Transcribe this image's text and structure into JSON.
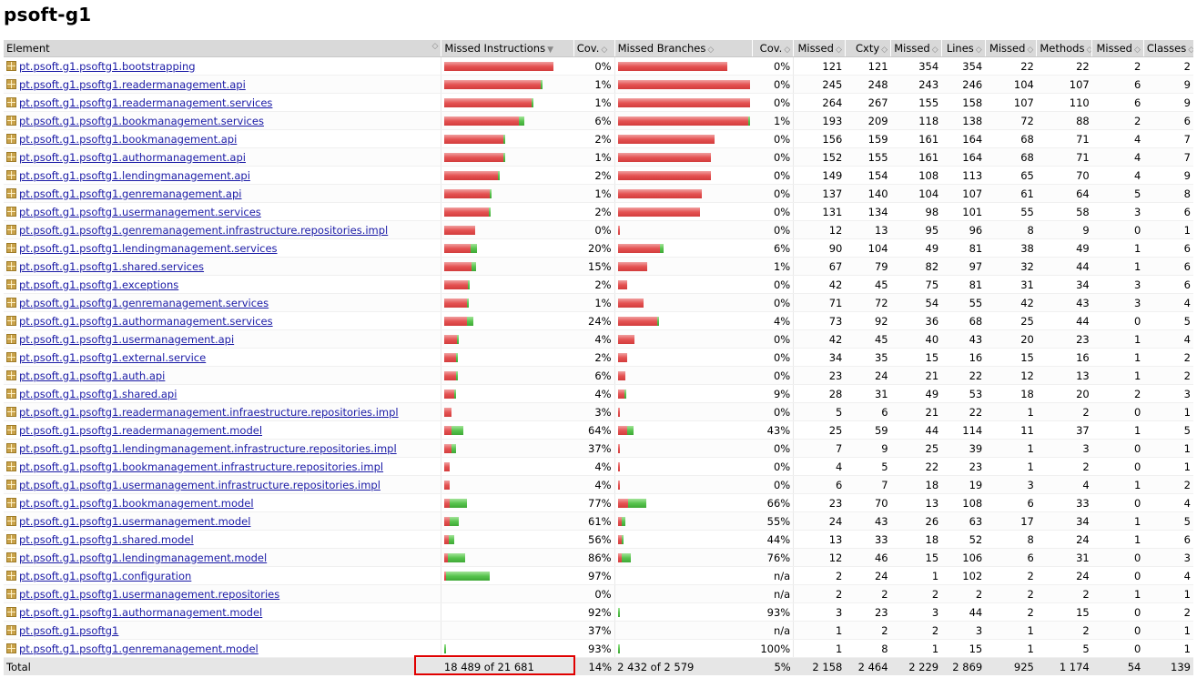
{
  "page_title": "psoft-g1",
  "colors": {
    "missed_bar": "#e55353",
    "covered_bar": "#58c44e",
    "highlight": "#e00000"
  },
  "icons": {
    "package": "package-icon",
    "sort": "sort-icon"
  },
  "headers": [
    "Element",
    "Missed Instructions",
    "Cov.",
    "Missed Branches",
    "Cov.",
    "Missed",
    "Cxty",
    "Missed",
    "Lines",
    "Missed",
    "Methods",
    "Missed",
    "Classes"
  ],
  "rows": [
    {
      "name": "pt.psoft.g1.psoftg1.bootstrapping",
      "mi": 100,
      "ci": 0,
      "icov": "0%",
      "mb": 100,
      "cb": 0,
      "bcov": "0%",
      "mc": "121",
      "cx": "121",
      "ml": "354",
      "ln": "354",
      "mm": "22",
      "mt": "22",
      "mcl": "2",
      "cl": "2"
    },
    {
      "name": "pt.psoft.g1.psoftg1.readermanagement.api",
      "mi": 88,
      "ci": 1,
      "icov": "1%",
      "mb": 142,
      "cb": 0,
      "bcov": "0%",
      "mc": "245",
      "cx": "248",
      "ml": "243",
      "ln": "246",
      "mm": "104",
      "mt": "107",
      "mcl": "6",
      "cl": "9"
    },
    {
      "name": "pt.psoft.g1.psoftg1.readermanagement.services",
      "mi": 80,
      "ci": 1,
      "icov": "1%",
      "mb": 153,
      "cb": 0,
      "bcov": "0%",
      "mc": "264",
      "cx": "267",
      "ml": "155",
      "ln": "158",
      "mm": "107",
      "mt": "110",
      "mcl": "6",
      "cl": "9"
    },
    {
      "name": "pt.psoft.g1.psoftg1.bookmanagement.services",
      "mi": 68,
      "ci": 5,
      "icov": "6%",
      "mb": 119,
      "cb": 2,
      "bcov": "1%",
      "mc": "193",
      "cx": "209",
      "ml": "118",
      "ln": "138",
      "mm": "72",
      "mt": "88",
      "mcl": "2",
      "cl": "6"
    },
    {
      "name": "pt.psoft.g1.psoftg1.bookmanagement.api",
      "mi": 54,
      "ci": 1,
      "icov": "2%",
      "mb": 88,
      "cb": 0,
      "bcov": "0%",
      "mc": "156",
      "cx": "159",
      "ml": "161",
      "ln": "164",
      "mm": "68",
      "mt": "71",
      "mcl": "4",
      "cl": "7"
    },
    {
      "name": "pt.psoft.g1.psoftg1.authormanagement.api",
      "mi": 54,
      "ci": 1,
      "icov": "1%",
      "mb": 85,
      "cb": 0,
      "bcov": "0%",
      "mc": "152",
      "cx": "155",
      "ml": "161",
      "ln": "164",
      "mm": "68",
      "mt": "71",
      "mcl": "4",
      "cl": "7"
    },
    {
      "name": "pt.psoft.g1.psoftg1.lendingmanagement.api",
      "mi": 49,
      "ci": 1,
      "icov": "2%",
      "mb": 85,
      "cb": 0,
      "bcov": "0%",
      "mc": "149",
      "cx": "154",
      "ml": "108",
      "ln": "113",
      "mm": "65",
      "mt": "70",
      "mcl": "4",
      "cl": "9"
    },
    {
      "name": "pt.psoft.g1.psoftg1.genremanagement.api",
      "mi": 42,
      "ci": 1,
      "icov": "1%",
      "mb": 77,
      "cb": 0,
      "bcov": "0%",
      "mc": "137",
      "cx": "140",
      "ml": "104",
      "ln": "107",
      "mm": "61",
      "mt": "64",
      "mcl": "5",
      "cl": "8"
    },
    {
      "name": "pt.psoft.g1.psoftg1.usermanagement.services",
      "mi": 41,
      "ci": 1,
      "icov": "2%",
      "mb": 75,
      "cb": 0,
      "bcov": "0%",
      "mc": "131",
      "cx": "134",
      "ml": "98",
      "ln": "101",
      "mm": "55",
      "mt": "58",
      "mcl": "3",
      "cl": "6"
    },
    {
      "name": "pt.psoft.g1.psoftg1.genremanagement.infrastructure.repositories.impl",
      "mi": 28,
      "ci": 0,
      "icov": "0%",
      "mb": 2,
      "cb": 0,
      "bcov": "0%",
      "mc": "12",
      "cx": "13",
      "ml": "95",
      "ln": "96",
      "mm": "8",
      "mt": "9",
      "mcl": "0",
      "cl": "1"
    },
    {
      "name": "pt.psoft.g1.psoftg1.lendingmanagement.services",
      "mi": 24,
      "ci": 6,
      "icov": "20%",
      "mb": 38,
      "cb": 3,
      "bcov": "6%",
      "mc": "90",
      "cx": "104",
      "ml": "49",
      "ln": "81",
      "mm": "38",
      "mt": "49",
      "mcl": "1",
      "cl": "6"
    },
    {
      "name": "pt.psoft.g1.psoftg1.shared.services",
      "mi": 25,
      "ci": 4,
      "icov": "15%",
      "mb": 27,
      "cb": 0,
      "bcov": "1%",
      "mc": "67",
      "cx": "79",
      "ml": "82",
      "ln": "97",
      "mm": "32",
      "mt": "44",
      "mcl": "1",
      "cl": "6"
    },
    {
      "name": "pt.psoft.g1.psoftg1.exceptions",
      "mi": 22,
      "ci": 1,
      "icov": "2%",
      "mb": 8,
      "cb": 0,
      "bcov": "0%",
      "mc": "42",
      "cx": "45",
      "ml": "75",
      "ln": "81",
      "mm": "31",
      "mt": "34",
      "mcl": "3",
      "cl": "6"
    },
    {
      "name": "pt.psoft.g1.psoftg1.genremanagement.services",
      "mi": 21,
      "ci": 1,
      "icov": "1%",
      "mb": 23,
      "cb": 0,
      "bcov": "0%",
      "mc": "71",
      "cx": "72",
      "ml": "54",
      "ln": "55",
      "mm": "42",
      "mt": "43",
      "mcl": "3",
      "cl": "4"
    },
    {
      "name": "pt.psoft.g1.psoftg1.authormanagement.services",
      "mi": 21,
      "ci": 6,
      "icov": "24%",
      "mb": 36,
      "cb": 1,
      "bcov": "4%",
      "mc": "73",
      "cx": "92",
      "ml": "36",
      "ln": "68",
      "mm": "25",
      "mt": "44",
      "mcl": "0",
      "cl": "5"
    },
    {
      "name": "pt.psoft.g1.psoftg1.usermanagement.api",
      "mi": 12,
      "ci": 1,
      "icov": "4%",
      "mb": 15,
      "cb": 0,
      "bcov": "0%",
      "mc": "42",
      "cx": "45",
      "ml": "40",
      "ln": "43",
      "mm": "20",
      "mt": "23",
      "mcl": "1",
      "cl": "4"
    },
    {
      "name": "pt.psoft.g1.psoftg1.external.service",
      "mi": 11,
      "ci": 1,
      "icov": "2%",
      "mb": 8,
      "cb": 0,
      "bcov": "0%",
      "mc": "34",
      "cx": "35",
      "ml": "15",
      "ln": "16",
      "mm": "15",
      "mt": "16",
      "mcl": "1",
      "cl": "2"
    },
    {
      "name": "pt.psoft.g1.psoftg1.auth.api",
      "mi": 11,
      "ci": 1,
      "icov": "6%",
      "mb": 7,
      "cb": 0,
      "bcov": "0%",
      "mc": "23",
      "cx": "24",
      "ml": "21",
      "ln": "22",
      "mm": "12",
      "mt": "13",
      "mcl": "1",
      "cl": "2"
    },
    {
      "name": "pt.psoft.g1.psoftg1.shared.api",
      "mi": 9,
      "ci": 1,
      "icov": "4%",
      "mb": 6,
      "cb": 1,
      "bcov": "9%",
      "mc": "28",
      "cx": "31",
      "ml": "49",
      "ln": "53",
      "mm": "18",
      "mt": "20",
      "mcl": "2",
      "cl": "3"
    },
    {
      "name": "pt.psoft.g1.psoftg1.readermanagement.infraestructure.repositories.impl",
      "mi": 7,
      "ci": 0,
      "icov": "3%",
      "mb": 2,
      "cb": 0,
      "bcov": "0%",
      "mc": "5",
      "cx": "6",
      "ml": "21",
      "ln": "22",
      "mm": "1",
      "mt": "2",
      "mcl": "0",
      "cl": "1"
    },
    {
      "name": "pt.psoft.g1.psoftg1.readermanagement.model",
      "mi": 7,
      "ci": 11,
      "icov": "64%",
      "mb": 8,
      "cb": 6,
      "bcov": "43%",
      "mc": "25",
      "cx": "59",
      "ml": "44",
      "ln": "114",
      "mm": "11",
      "mt": "37",
      "mcl": "1",
      "cl": "5"
    },
    {
      "name": "pt.psoft.g1.psoftg1.lendingmanagement.infrastructure.repositories.impl",
      "mi": 7,
      "ci": 4,
      "icov": "37%",
      "mb": 2,
      "cb": 0,
      "bcov": "0%",
      "mc": "7",
      "cx": "9",
      "ml": "25",
      "ln": "39",
      "mm": "1",
      "mt": "3",
      "mcl": "0",
      "cl": "1"
    },
    {
      "name": "pt.psoft.g1.psoftg1.bookmanagement.infrastructure.repositories.impl",
      "mi": 5,
      "ci": 0,
      "icov": "4%",
      "mb": 2,
      "cb": 0,
      "bcov": "0%",
      "mc": "4",
      "cx": "5",
      "ml": "22",
      "ln": "23",
      "mm": "1",
      "mt": "2",
      "mcl": "0",
      "cl": "1"
    },
    {
      "name": "pt.psoft.g1.psoftg1.usermanagement.infrastructure.repositories.impl",
      "mi": 5,
      "ci": 0,
      "icov": "4%",
      "mb": 2,
      "cb": 0,
      "bcov": "0%",
      "mc": "6",
      "cx": "7",
      "ml": "18",
      "ln": "19",
      "mm": "3",
      "mt": "4",
      "mcl": "1",
      "cl": "2"
    },
    {
      "name": "pt.psoft.g1.psoftg1.bookmanagement.model",
      "mi": 5,
      "ci": 16,
      "icov": "77%",
      "mb": 9,
      "cb": 17,
      "bcov": "66%",
      "mc": "23",
      "cx": "70",
      "ml": "13",
      "ln": "108",
      "mm": "6",
      "mt": "33",
      "mcl": "0",
      "cl": "4"
    },
    {
      "name": "pt.psoft.g1.psoftg1.usermanagement.model",
      "mi": 5,
      "ci": 8,
      "icov": "61%",
      "mb": 3,
      "cb": 3,
      "bcov": "55%",
      "mc": "24",
      "cx": "43",
      "ml": "26",
      "ln": "63",
      "mm": "17",
      "mt": "34",
      "mcl": "1",
      "cl": "5"
    },
    {
      "name": "pt.psoft.g1.psoftg1.shared.model",
      "mi": 4,
      "ci": 5,
      "icov": "56%",
      "mb": 3,
      "cb": 2,
      "bcov": "44%",
      "mc": "13",
      "cx": "33",
      "ml": "18",
      "ln": "52",
      "mm": "8",
      "mt": "24",
      "mcl": "1",
      "cl": "6"
    },
    {
      "name": "pt.psoft.g1.psoftg1.lendingmanagement.model",
      "mi": 3,
      "ci": 16,
      "icov": "86%",
      "mb": 3,
      "cb": 8,
      "bcov": "76%",
      "mc": "12",
      "cx": "46",
      "ml": "15",
      "ln": "106",
      "mm": "6",
      "mt": "31",
      "mcl": "0",
      "cl": "3"
    },
    {
      "name": "pt.psoft.g1.psoftg1.configuration",
      "mi": 1,
      "ci": 40,
      "icov": "97%",
      "mb": 0,
      "cb": 0,
      "bcov": "n/a",
      "mc": "2",
      "cx": "24",
      "ml": "1",
      "ln": "102",
      "mm": "2",
      "mt": "24",
      "mcl": "0",
      "cl": "4"
    },
    {
      "name": "pt.psoft.g1.psoftg1.usermanagement.repositories",
      "mi": 0,
      "ci": 0,
      "icov": "0%",
      "mb": 0,
      "cb": 0,
      "bcov": "n/a",
      "mc": "2",
      "cx": "2",
      "ml": "2",
      "ln": "2",
      "mm": "2",
      "mt": "2",
      "mcl": "1",
      "cl": "1"
    },
    {
      "name": "pt.psoft.g1.psoftg1.authormanagement.model",
      "mi": 0,
      "ci": 0,
      "icov": "92%",
      "mb": 0,
      "cb": 2,
      "bcov": "93%",
      "mc": "3",
      "cx": "23",
      "ml": "3",
      "ln": "44",
      "mm": "2",
      "mt": "15",
      "mcl": "0",
      "cl": "2"
    },
    {
      "name": "pt.psoft.g1.psoftg1",
      "mi": 0,
      "ci": 0,
      "icov": "37%",
      "mb": 0,
      "cb": 0,
      "bcov": "n/a",
      "mc": "1",
      "cx": "2",
      "ml": "2",
      "ln": "3",
      "mm": "1",
      "mt": "2",
      "mcl": "0",
      "cl": "1"
    },
    {
      "name": "pt.psoft.g1.psoftg1.genremanagement.model",
      "mi": 0,
      "ci": 1,
      "icov": "93%",
      "mb": 0,
      "cb": 1,
      "bcov": "100%",
      "mc": "1",
      "cx": "8",
      "ml": "1",
      "ln": "15",
      "mm": "1",
      "mt": "5",
      "mcl": "0",
      "cl": "1"
    }
  ],
  "total": {
    "label": "Total",
    "instructions": "18 489 of 21 681",
    "icov": "14%",
    "branches": "2 432 of 2 579",
    "bcov": "5%",
    "mc": "2 158",
    "cx": "2 464",
    "ml": "2 229",
    "ln": "2 869",
    "mm": "925",
    "mt": "1 174",
    "mcl": "54",
    "cl": "139"
  }
}
